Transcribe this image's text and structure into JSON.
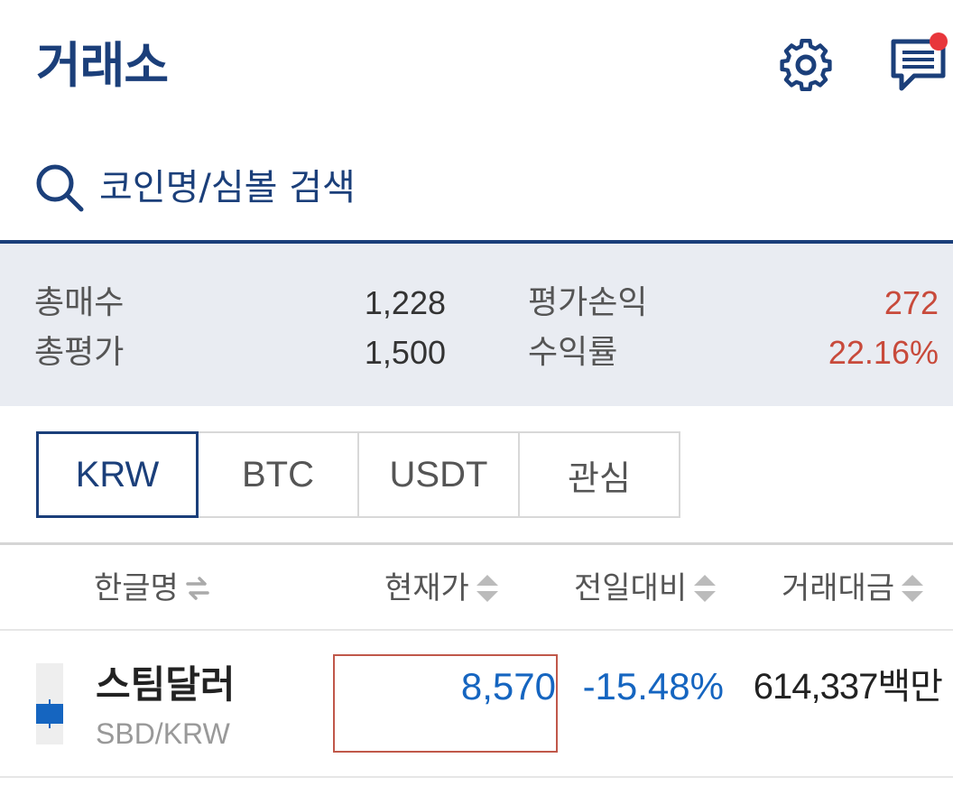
{
  "header": {
    "title": "거래소",
    "icons": [
      "gear-icon",
      "chat-icon"
    ],
    "notification_color": "#e8363b",
    "accent": "#1b3f7a"
  },
  "search": {
    "placeholder": "코인명/심볼 검색",
    "icon": "search-icon"
  },
  "summary": {
    "total_buy_label": "총매수",
    "total_buy_value": "1,228",
    "total_eval_label": "총평가",
    "total_eval_value": "1,500",
    "pnl_label": "평가손익",
    "pnl_value": "272",
    "return_label": "수익률",
    "return_value": "22.16%",
    "positive_color": "#c84a3b"
  },
  "tabs": [
    {
      "label": "KRW",
      "active": true
    },
    {
      "label": "BTC",
      "active": false
    },
    {
      "label": "USDT",
      "active": false
    },
    {
      "label": "관심",
      "active": false
    }
  ],
  "table": {
    "columns": [
      {
        "label": "한글명",
        "sort_icon": "swap-icon"
      },
      {
        "label": "현재가",
        "sort_icon": "sort-icon"
      },
      {
        "label": "전일대비",
        "sort_icon": "sort-icon"
      },
      {
        "label": "거래대금",
        "sort_icon": "sort-icon"
      }
    ],
    "rows": [
      {
        "name": "스팀달러",
        "symbol": "SBD/KRW",
        "price": "8,570",
        "change": "-15.48%",
        "volume": "614,337백만",
        "down_color": "#1565c0"
      }
    ]
  }
}
